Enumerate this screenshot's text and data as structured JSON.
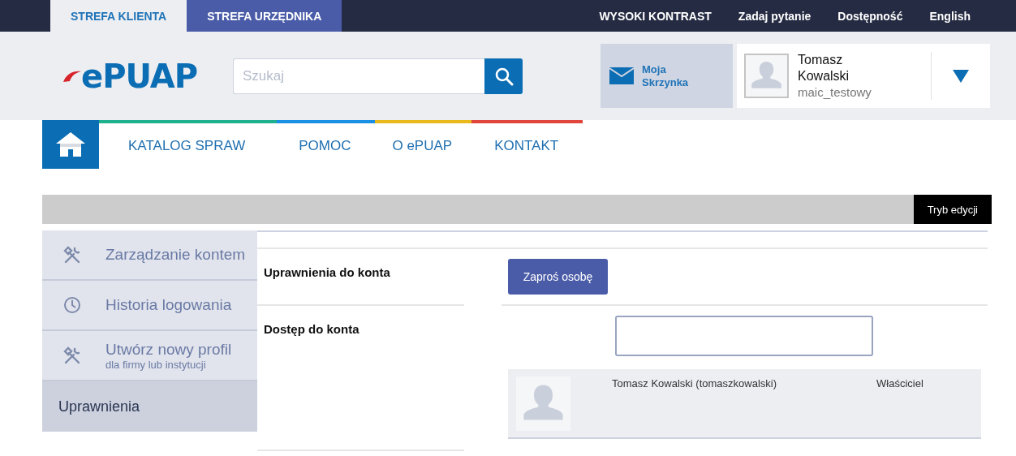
{
  "zone_tabs": [
    {
      "label": "STREFA KLIENTA",
      "selected": true
    },
    {
      "label": "STREFA URZĘDNIKA",
      "selected": false
    }
  ],
  "top_links": [
    "WYSOKI KONTRAST",
    "Zadaj pytanie",
    "Dostępność",
    "English"
  ],
  "logo": "ePUAP",
  "search": {
    "placeholder": "Szukaj"
  },
  "mailbox": "Moja Skrzynka",
  "user": {
    "name": "Tomasz Kowalski",
    "login": "maic_testowy"
  },
  "nav": [
    "KATALOG SPRAW",
    "POMOC",
    "O ePUAP",
    "KONTAKT"
  ],
  "edit_mode_button": "Tryb edycji",
  "sidebar": [
    {
      "label": "Zarządzanie kontem",
      "kind": "tools",
      "selected": false
    },
    {
      "label": "Historia logowania",
      "kind": "clock",
      "selected": false
    },
    {
      "label": "Utwórz nowy profil",
      "sublabel": "dla firmy lub instytucji",
      "kind": "tools",
      "selected": false
    },
    {
      "label": "Uprawnienia",
      "kind": "plain",
      "selected": true
    }
  ],
  "sections": [
    "Uprawnienia do konta",
    "Dostęp do konta"
  ],
  "invite_button": "Zaproś osobę",
  "members": [
    {
      "name": "Tomasz Kowalski (tomaszkowalski)",
      "role": "Właściciel"
    }
  ]
}
